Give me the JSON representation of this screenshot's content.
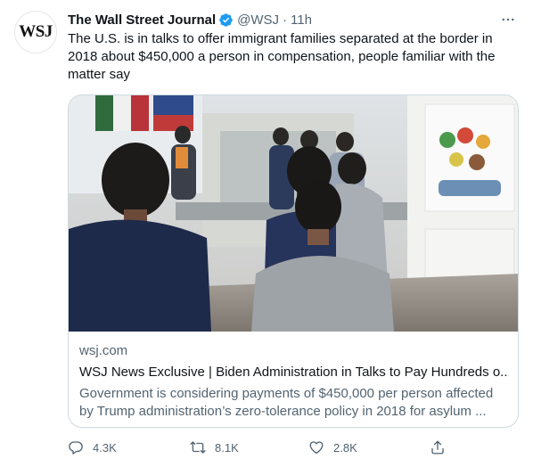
{
  "author": {
    "avatar_text": "WSJ",
    "name": "The Wall Street Journal",
    "handle": "@WSJ",
    "separator": "·",
    "time": "11h"
  },
  "tweet": {
    "text": "The U.S. is in talks to offer immigrant families separated at the border in 2018 about $450,000 a person in compensation, people familiar with the matter say"
  },
  "card": {
    "domain": "wsj.com",
    "title": "WSJ News Exclusive | Biden Administration in Talks to Pay Hundreds o...",
    "description": "Government is considering payments of $450,000 per person affected by Trump administration’s zero-tolerance policy in 2018 for asylum ..."
  },
  "actions": {
    "reply_count": "4.3K",
    "retweet_count": "8.1K",
    "like_count": "2.8K"
  },
  "icons": {
    "verified": "verified-badge-icon",
    "more": "more-options-icon",
    "reply": "reply-icon",
    "retweet": "retweet-icon",
    "like": "heart-icon",
    "share": "share-icon"
  },
  "colors": {
    "text_primary": "#0f1419",
    "text_secondary": "#536471",
    "verified_blue": "#1d9bf0",
    "border": "#cfd9de"
  }
}
